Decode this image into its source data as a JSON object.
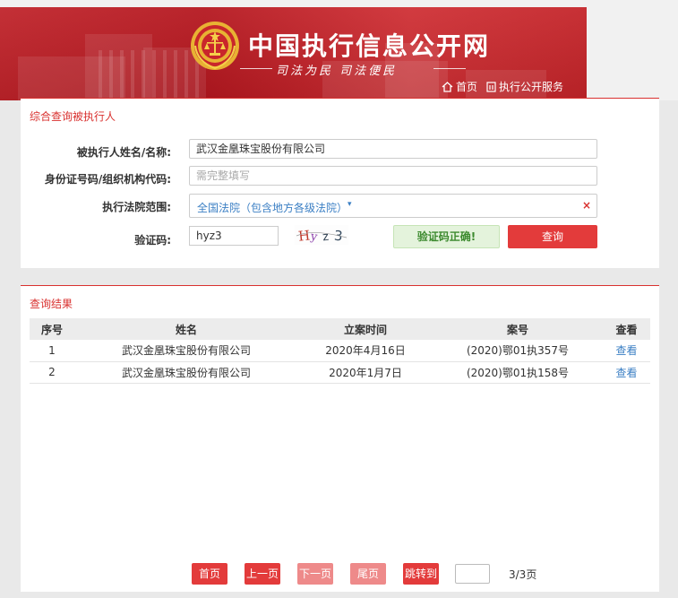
{
  "header": {
    "site_title": "中国执行信息公开网",
    "slogan": "司法为民  司法便民",
    "nav": [
      {
        "label": "首页",
        "icon": "home-icon"
      },
      {
        "label": "执行公开服务",
        "icon": "document-icon"
      }
    ]
  },
  "search": {
    "title": "综合查询被执行人",
    "name_label": "被执行人姓名/名称:",
    "name_value": "武汉金凰珠宝股份有限公司",
    "id_label": "身份证号码/组织机构代码:",
    "id_placeholder": "需完整填写",
    "court_label": "执行法院范围:",
    "court_value": "全国法院（包含地方各级法院）",
    "court_clear": "×",
    "captcha_label": "验证码:",
    "captcha_value": "hyz3",
    "captcha_image_text": "Hyz3",
    "captcha_status": "验证码正确!",
    "search_button": "查询"
  },
  "results": {
    "title": "查询结果",
    "columns": [
      "序号",
      "姓名",
      "立案时间",
      "案号",
      "查看"
    ],
    "rows": [
      {
        "index": "1",
        "name": "武汉金凰珠宝股份有限公司",
        "date": "2020年4月16日",
        "case_no": "(2020)鄂01执357号",
        "view": "查看"
      },
      {
        "index": "2",
        "name": "武汉金凰珠宝股份有限公司",
        "date": "2020年1月7日",
        "case_no": "(2020)鄂01执158号",
        "view": "查看"
      }
    ]
  },
  "pagination": {
    "first": "首页",
    "prev": "上一页",
    "next": "下一页",
    "last": "尾页",
    "jump": "跳转到",
    "page_info": "3/3页"
  },
  "colors": {
    "brand_red": "#d9312f",
    "button_red": "#e33b3b",
    "link_blue": "#3b7fc4",
    "success_green": "#3c8a2e"
  }
}
